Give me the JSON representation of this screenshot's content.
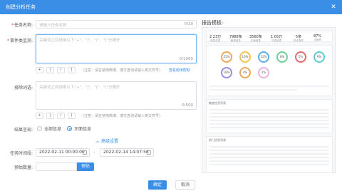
{
  "dialog": {
    "title": "创建分析任务",
    "close_icon": "close-icon"
  },
  "form": {
    "task_name": {
      "label": "任务名称:",
      "placeholder": "请输入任务名称",
      "counter": "0/30"
    },
    "event_query": {
      "label": "事件类监测:",
      "placeholder": "关键词之间请用以下\"+\"、\"|\"、\"(\"、\")\"分隔开",
      "counter": "0/1000",
      "hint": "(注意：请在使用微博、博文查询请输入英文符号)",
      "link": "查看使用帮助"
    },
    "exclude_words": {
      "label": "排除词语:",
      "placeholder": "关键词之间请用以下\"+\"、\"|\"、\"(\"、\")\"分隔开",
      "counter": "0/500",
      "hint": "(注意：请在使用微博、博文查询请输入英文符号)"
    },
    "operators": [
      "+",
      "|",
      "(",
      ")"
    ],
    "info_type": {
      "label": "结果呈现:",
      "options": [
        "全部信息",
        "正面信息"
      ],
      "selected": 1
    },
    "advanced_link": "高级设置",
    "time_range": {
      "label": "任务时间段:",
      "start": "2022-02-11 00:00:00",
      "end": "2022-02-14 14:07:56",
      "separator": "-"
    },
    "qty": {
      "label": "预估数量:",
      "button": "预估"
    }
  },
  "buttons": {
    "confirm": "确定",
    "cancel": "取消"
  },
  "preview": {
    "title": "报告模板:",
    "stats": [
      {
        "v": "2.23万",
        "k": "信息总量"
      },
      {
        "v": "7988条",
        "k": "敏感信息"
      },
      {
        "v": "3560条",
        "k": "正面信息"
      },
      {
        "v": "1.05万",
        "k": "中性信息"
      },
      {
        "v": "5条",
        "k": "热点事件"
      },
      {
        "v": "87%",
        "k": "正面率"
      }
    ],
    "circles": [
      "25%",
      "16%",
      "12%",
      "8%",
      "5%",
      "9%",
      "18%",
      "4%",
      "2%"
    ],
    "table1_title": "敏感信息列表",
    "table2_title": "热门信息列表"
  },
  "colors": {
    "accent": "#3a8ee6",
    "title_bar": "#3a8ee6"
  }
}
